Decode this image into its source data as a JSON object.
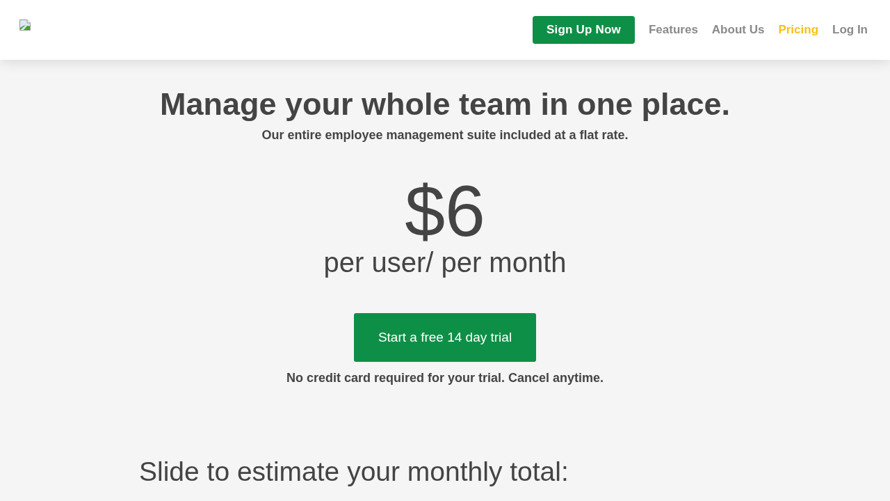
{
  "header": {
    "signup_button": "Sign Up Now",
    "nav": [
      {
        "label": "Features",
        "selected": false
      },
      {
        "label": "About Us",
        "selected": false
      },
      {
        "label": "Pricing",
        "selected": true
      },
      {
        "label": "Log In",
        "selected": false
      }
    ]
  },
  "hero": {
    "title": "Manage your whole team in one place.",
    "subtitle": "Our entire employee management suite included at a flat rate.",
    "price": "$6",
    "price_unit": "per user/ per month",
    "cta_button": "Start a free 14 day trial",
    "note": "No credit card required for your trial. Cancel anytime."
  },
  "estimator": {
    "heading": "Slide to estimate your monthly total:"
  }
}
